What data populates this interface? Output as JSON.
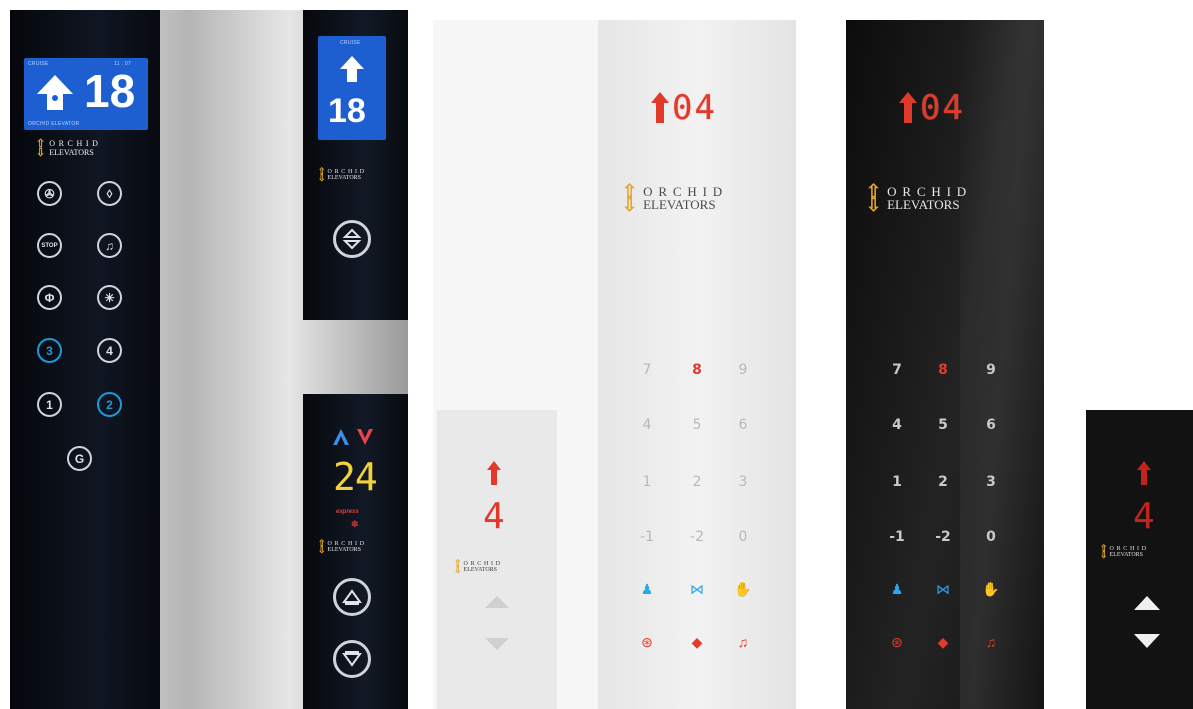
{
  "brand": {
    "line1": "ORCHID",
    "line2": "ELEVATORS"
  },
  "left_photo": {
    "main_display": {
      "floor": "18",
      "status_left": "CRUISE",
      "status_right": "11 : 07",
      "footer": "ORCHID ELEVATOR"
    },
    "hall_display": {
      "floor": "18",
      "status": "CRUISE"
    },
    "buttons": [
      {
        "label": "fan-icon"
      },
      {
        "label": "light-icon"
      },
      {
        "label": "STOP"
      },
      {
        "label": "bell-icon"
      },
      {
        "label": "door-open-icon"
      },
      {
        "label": "fire-icon"
      },
      {
        "label": "3"
      },
      {
        "label": "4"
      },
      {
        "label": "1"
      },
      {
        "label": "2"
      },
      {
        "label": "G"
      }
    ],
    "lower_panel": {
      "floor": "24",
      "caption": "express"
    }
  },
  "white_main": {
    "display": "04",
    "keys": [
      "7",
      "8",
      "9",
      "4",
      "5",
      "6",
      "1",
      "2",
      "3",
      "-1",
      "-2",
      "0"
    ]
  },
  "black_main": {
    "display": "04",
    "keys": [
      "7",
      "8",
      "9",
      "4",
      "5",
      "6",
      "1",
      "2",
      "3",
      "-1",
      "-2",
      "0"
    ]
  },
  "white_small": {
    "floor": "4"
  },
  "black_small": {
    "floor": "4"
  },
  "colors": {
    "accent_red": "#e23a2b",
    "accent_blue": "#1e9ad8",
    "logo_gold": "#e4a62a",
    "lcd_blue": "#1d5fd1"
  }
}
